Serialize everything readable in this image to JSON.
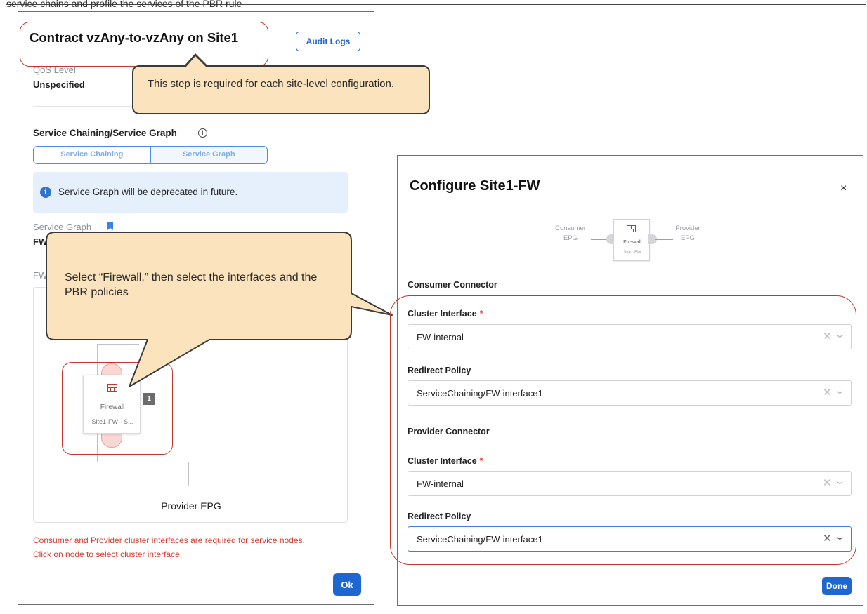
{
  "top_fragment": "service chains and profile the services of the PBR rule",
  "left_panel": {
    "title": "Contract vzAny-to-vzAny on Site1",
    "audit_button": "Audit Logs",
    "qos_label": "QoS Level",
    "qos_value": "Unspecified",
    "section_title": "Service Chaining/Service Graph",
    "info_icon": "info-circle-icon",
    "tabs": [
      {
        "label": "Service Chaining"
      },
      {
        "label": "Service Graph"
      }
    ],
    "banner_text": "Service Graph will be deprecated in future.",
    "service_graph_label": "Service Graph",
    "service_graph_value": "FW",
    "fw_label": "FW",
    "node": {
      "name": "Firewall",
      "sub": "Site1-FW - S...",
      "badge": "1"
    },
    "provider_label": "Provider EPG",
    "error_line1": "Consumer and Provider cluster interfaces are required for service nodes.",
    "error_line2": "Click on node to select cluster interface.",
    "ok_button": "Ok"
  },
  "callouts": {
    "step": "This step is required for each site-level configuration.",
    "select": "Select “Firewall,” then select the interfaces and the PBR policies"
  },
  "right_panel": {
    "title": "Configure Site1-FW",
    "close": "×",
    "chain": {
      "consumer_top": "Consumer",
      "consumer_bottom": "EPG",
      "node_name": "Firewall",
      "node_sub": "Site1-FW",
      "provider_top": "Provider",
      "provider_bottom": "EPG"
    },
    "consumer_section": "Consumer Connector",
    "provider_section": "Provider Connector",
    "consumer_cluster_label": "Cluster Interface",
    "consumer_cluster_value": "FW-internal",
    "consumer_redirect_label": "Redirect Policy",
    "consumer_redirect_value": "ServiceChaining/FW-interface1",
    "provider_cluster_label": "Cluster Interface",
    "provider_cluster_value": "FW-internal",
    "provider_redirect_label": "Redirect Policy",
    "provider_redirect_value": "ServiceChaining/FW-interface1",
    "required_mark": "*",
    "clear_glyph": "✕",
    "chevron_glyph": "⌄",
    "done_button": "Done"
  },
  "colors": {
    "accent": "#1e66d0",
    "error": "#d93a2b",
    "annotation": "#c0392b",
    "callout_fill": "#fbe3bd"
  }
}
